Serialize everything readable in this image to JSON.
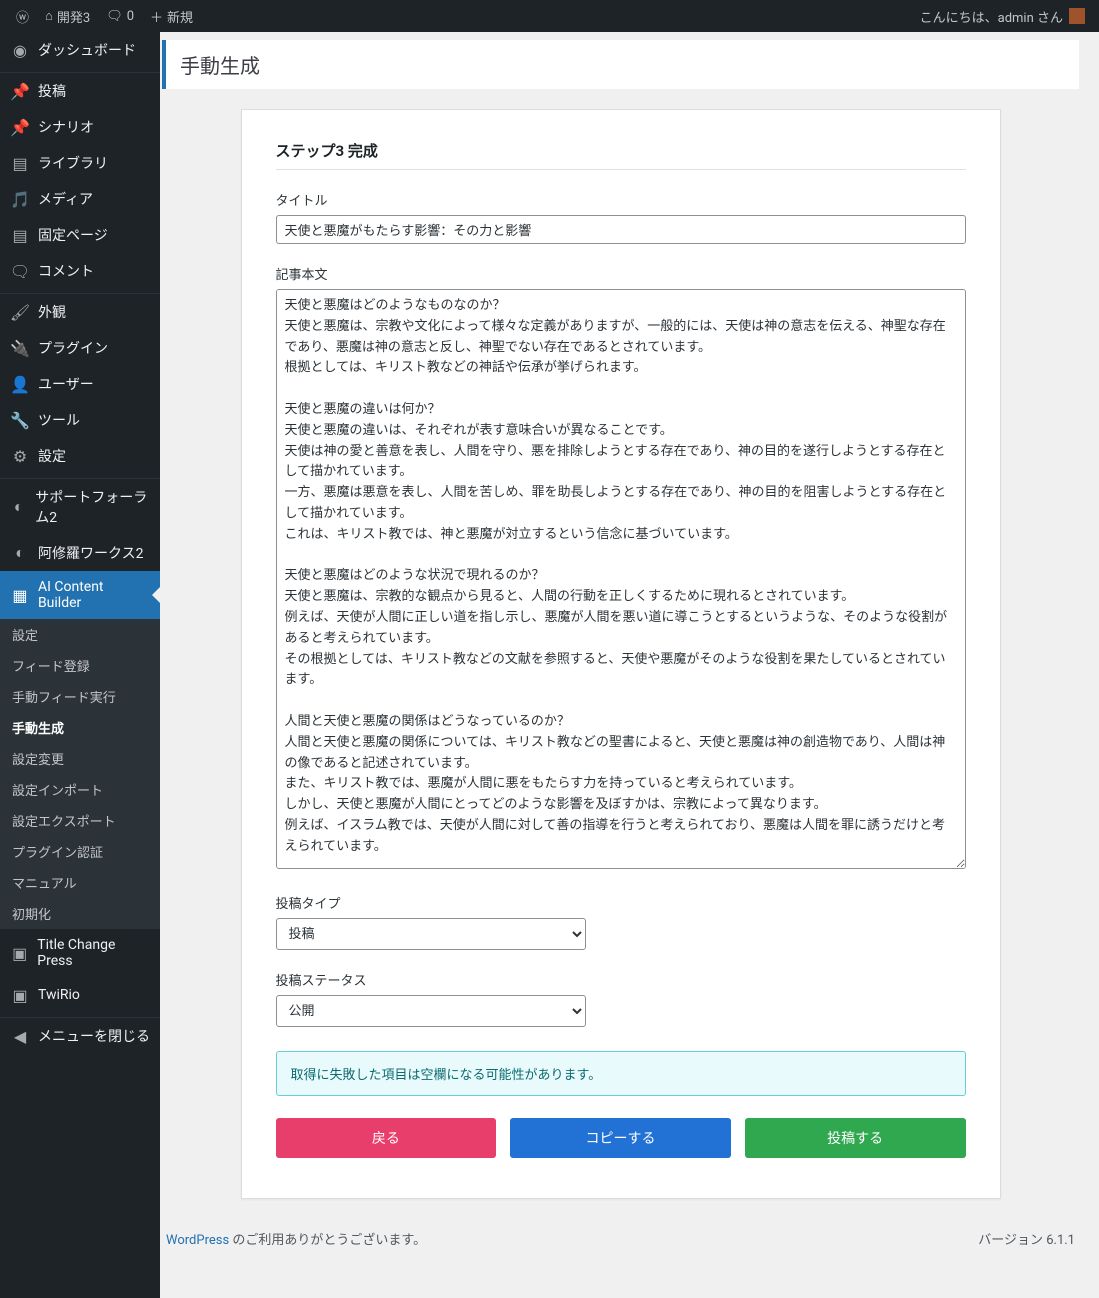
{
  "topbar": {
    "site_name": "開発3",
    "comments": "0",
    "new": "新規",
    "greeting": "こんにちは、admin さん"
  },
  "sidebar": {
    "items": [
      {
        "icon": "dashboard",
        "label": "ダッシュボード"
      },
      {
        "icon": "pin",
        "label": "投稿"
      },
      {
        "icon": "pin",
        "label": "シナリオ"
      },
      {
        "icon": "book",
        "label": "ライブラリ"
      },
      {
        "icon": "media",
        "label": "メディア"
      },
      {
        "icon": "page",
        "label": "固定ページ"
      },
      {
        "icon": "comment",
        "label": "コメント"
      },
      {
        "icon": "brush",
        "label": "外観"
      },
      {
        "icon": "plug",
        "label": "プラグイン"
      },
      {
        "icon": "user",
        "label": "ユーザー"
      },
      {
        "icon": "tool",
        "label": "ツール"
      },
      {
        "icon": "settings",
        "label": "設定"
      },
      {
        "icon": "support",
        "label": "サポートフォーラム2"
      },
      {
        "icon": "support",
        "label": "阿修羅ワークス2"
      },
      {
        "icon": "ai",
        "label": "AI Content Builder"
      },
      {
        "icon": "title",
        "label": "Title Change Press"
      },
      {
        "icon": "twirio",
        "label": "TwiRio"
      },
      {
        "icon": "collapse",
        "label": "メニューを閉じる"
      }
    ],
    "submenu": [
      "設定",
      "フィード登録",
      "手動フィード実行",
      "手動生成",
      "設定変更",
      "設定インポート",
      "設定エクスポート",
      "プラグイン認証",
      "マニュアル",
      "初期化"
    ]
  },
  "page": {
    "title": "手動生成",
    "step_header": "ステップ3 完成",
    "field_title_label": "タイトル",
    "field_title_value": "天使と悪魔がもたらす影響：その力と影響",
    "field_body_label": "記事本文",
    "field_body_value": "天使と悪魔はどのようなものなのか？\n天使と悪魔は、宗教や文化によって様々な定義がありますが、一般的には、天使は神の意志を伝える、神聖な存在であり、悪魔は神の意志と反し、神聖でない存在であるとされています。\n根拠としては、キリスト教などの神話や伝承が挙げられます。\n\n天使と悪魔の違いは何か？\n天使と悪魔の違いは、それぞれが表す意味合いが異なることです。\n天使は神の愛と善意を表し、人間を守り、悪を排除しようとする存在であり、神の目的を遂行しようとする存在として描かれています。\n一方、悪魔は悪意を表し、人間を苦しめ、罪を助長しようとする存在であり、神の目的を阻害しようとする存在として描かれています。\nこれは、キリスト教では、神と悪魔が対立するという信念に基づいています。\n\n天使と悪魔はどのような状況で現れるのか？\n天使と悪魔は、宗教的な観点から見ると、人間の行動を正しくするために現れるとされています。\n例えば、天使が人間に正しい道を指し示し、悪魔が人間を悪い道に導こうとするというような、そのような役割があると考えられています。\nその根拠としては、キリスト教などの文献を参照すると、天使や悪魔がそのような役割を果たしているとされています。\n\n人間と天使と悪魔の関係はどうなっているのか？\n人間と天使と悪魔の関係については、キリスト教などの聖書によると、天使と悪魔は神の創造物であり、人間は神の像であると記述されています。\nまた、キリスト教では、悪魔が人間に悪をもたらす力を持っていると考えられています。\nしかし、天使と悪魔が人間にとってどのような影響を及ぼすかは、宗教によって異なります。\n例えば、イスラム教では、天使が人間に対して善の指導を行うと考えられており、悪魔は人間を罪に誘うだけと考えられています。\n\n天使と悪魔がもたらす影響はどうなのか？\n天使と悪魔がもたらす影響は、人間がどのような行動を取るかに大きく影響を与えます。\n天使は人間に善行や正直な行動を促し、悪魔は悪行や不正な行動を促します。\nまた、天使と悪魔は人間の精神的な状態に影響を与えます。\n天使は人間に希望や勇気を与え、悪魔は恐怖や絶望を与えます。\nこれらの仮説は、宗教的な文献や神話などに書かれているものから導き出されています。\n\n\n【要約】\n天使と悪魔は、宗教や文化によって様々な定義があり、一般的には、天使は神の意志を伝える神聖な存在であり、悪魔は神の意志と反し、神聖でない存在であるとされています。天使と悪魔の違いは、それぞれが表す意味合いが異なることです。天使と悪魔は、人間の行動を正しくするために現れるとされており、キリスト教などの文献によると、天使と悪魔がそのような役割を果たしているとされています。人間と天使と悪魔の関係については、キリスト教などの聖書によると、天使と悪魔は神の創造物であり、人間は神の像であると記述されているとされています。",
    "field_posttype_label": "投稿タイプ",
    "field_posttype_value": "投稿",
    "field_status_label": "投稿ステータス",
    "field_status_value": "公開",
    "notice": "取得に失敗した項目は空欄になる可能性があります。",
    "btn_back": "戻る",
    "btn_copy": "コピーする",
    "btn_post": "投稿する"
  },
  "footer": {
    "thanks_prefix": "WordPress",
    "thanks_suffix": " のご利用ありがとうございます。",
    "version": "バージョン 6.1.1"
  }
}
